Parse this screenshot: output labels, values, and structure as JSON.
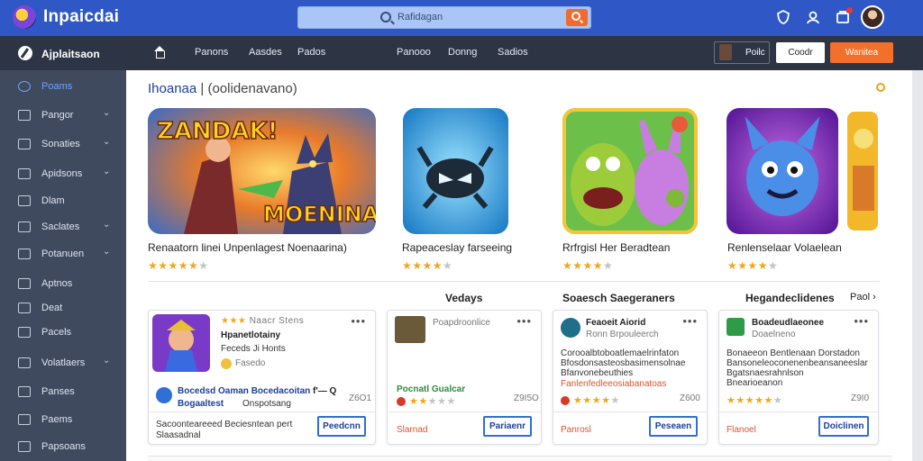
{
  "header": {
    "brand": "Inpaicdai",
    "search_placeholder": "Rafidagan",
    "icons": [
      "shield-icon",
      "people-icon",
      "notification-icon"
    ]
  },
  "sidebar": {
    "title": "Ajplaitsaon",
    "items": [
      {
        "label": "Poams",
        "active": true,
        "chevron": false
      },
      {
        "label": "Pangor",
        "active": false,
        "chevron": true
      },
      {
        "label": "Sonaties",
        "active": false,
        "chevron": true
      },
      {
        "label": "Apidsons",
        "active": false,
        "chevron": true
      },
      {
        "label": "Dlam",
        "active": false,
        "chevron": false
      },
      {
        "label": "Saclates",
        "active": false,
        "chevron": true
      },
      {
        "label": "Potanuen",
        "active": false,
        "chevron": true
      },
      {
        "label": "Aptnos",
        "active": false,
        "chevron": false
      },
      {
        "label": "Deat",
        "active": false,
        "chevron": false
      },
      {
        "label": "Pacels",
        "active": false,
        "chevron": false
      },
      {
        "label": "Volatlaers",
        "active": false,
        "chevron": true
      },
      {
        "label": "Panses",
        "active": false,
        "chevron": false
      },
      {
        "label": "Paems",
        "active": false,
        "chevron": false
      },
      {
        "label": "Papsoans",
        "active": false,
        "chevron": false
      }
    ]
  },
  "nav": {
    "links": [
      "Panons",
      "Aasdes",
      "Pados",
      "Panooo",
      "Donng",
      "Sadios"
    ],
    "user_button": "Poilc",
    "white_button": "Coodr",
    "orange_button": "Wanitea"
  },
  "featured": {
    "title": "Ihoanaa",
    "title_suffix": "| (oolidenavano)",
    "items": [
      {
        "name": "Renaatorn linei Unpenlagest Noenaarina)",
        "rating": 4.5,
        "art_text": "ZANDAK! ... MOENINA!"
      },
      {
        "name": "Rapeaceslay farseeing",
        "rating": 4.5
      },
      {
        "name": "Rrfrgisl Her Beradtean",
        "rating": 4.5
      },
      {
        "name": "Renlenselaar Volaelean",
        "rating": 4.5
      }
    ]
  },
  "sections": {
    "col1": "Vedays",
    "col2": "Soaesch Saegeraners",
    "col3": "Hegandeclidenes",
    "more": "Paol"
  },
  "cards": [
    {
      "tagline": "Naacr Stens",
      "title": "Hpanetlotainy",
      "sub": "Feceds Ji Honts",
      "meta": "Fasedo",
      "footer1": "Bocedsd Oaman Bocedacoitan",
      "footer1_suffix": "f'— Q",
      "footer2": "Bogaaltest",
      "footer2b": "Onspotsang",
      "count": "Z6O1",
      "desc1": "Sacoonteareeed Beciesntean pert",
      "desc2": "Slaasadnal",
      "button": "Peedcnn"
    },
    {
      "tagline": "Poapdroonlice",
      "green_label": "Pocnatl Gualcar",
      "count": "Z9I5O",
      "orange": "Slarnad",
      "button": "Pariaenr"
    },
    {
      "title": "Feaoeit Aiorid",
      "sub": "Ronn Brpouleerch",
      "desc": [
        "Corooalbtoboatlemaelrinfaton",
        "Bfosdonsasteosbasimensolnae",
        "Bfanvonebeuthies"
      ],
      "orange": "Fanlenfedleeosiabanatoas",
      "count": "Z600",
      "foot": "Panrosl",
      "button": "Peseaen"
    },
    {
      "title": "Boadeudlaeonee",
      "sub": "Doaelneno",
      "desc": [
        "Bonaeeon Bentlenaan Dorstadon",
        "Bansoneleoconenenbeansaneeslar",
        "Bgatsnaesrahnlson",
        "Bnearioeanon"
      ],
      "count": "Z9I0",
      "foot": "Flanoel",
      "button": "Doiclinen"
    }
  ],
  "colors": {
    "topbar": "#2f58c6",
    "sidebar": "#3f4a5e",
    "navbar": "#2d3443",
    "accent_orange": "#f3702b",
    "link_blue": "#1d3f99",
    "star": "#f0a720"
  }
}
